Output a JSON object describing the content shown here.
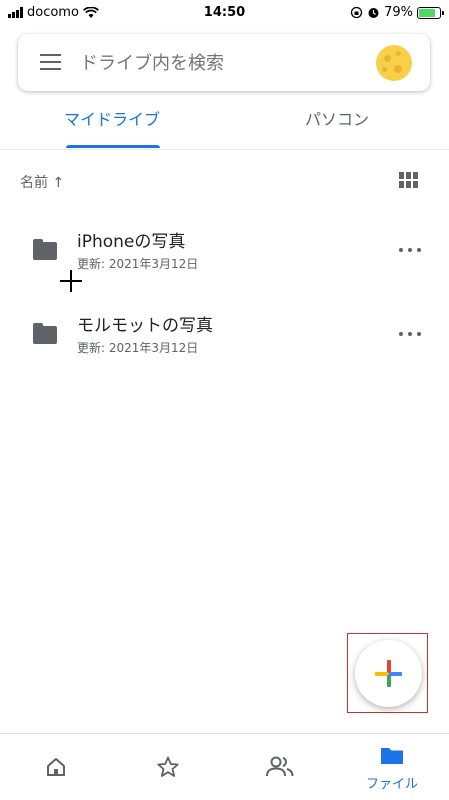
{
  "status_bar": {
    "carrier": "docomo",
    "time": "14:50",
    "battery_percent": "79%",
    "battery_level": 0.79
  },
  "search": {
    "placeholder": "ドライブ内を検索"
  },
  "tabs": [
    {
      "label": "マイドライブ",
      "active": true
    },
    {
      "label": "パソコン",
      "active": false
    }
  ],
  "sort": {
    "label": "名前 ↑"
  },
  "files": [
    {
      "name": "iPhoneの写真",
      "meta": "更新: 2021年3月12日",
      "icon": "folder-icon"
    },
    {
      "name": "モルモットの写真",
      "meta": "更新: 2021年3月12日",
      "icon": "folder-icon"
    }
  ],
  "bottom_nav": {
    "items": [
      {
        "icon": "home-icon",
        "label": ""
      },
      {
        "icon": "star-icon",
        "label": ""
      },
      {
        "icon": "shared-icon",
        "label": ""
      },
      {
        "icon": "folder-icon",
        "label": "ファイル",
        "active": true
      }
    ]
  },
  "colors": {
    "accent": "#1a73e8",
    "icon_gray": "#5f6368",
    "fab_highlight": "#d62d2d",
    "google_blue": "#4285f4",
    "google_red": "#ea4335",
    "google_yellow": "#fbbc04",
    "google_green": "#34a853"
  }
}
